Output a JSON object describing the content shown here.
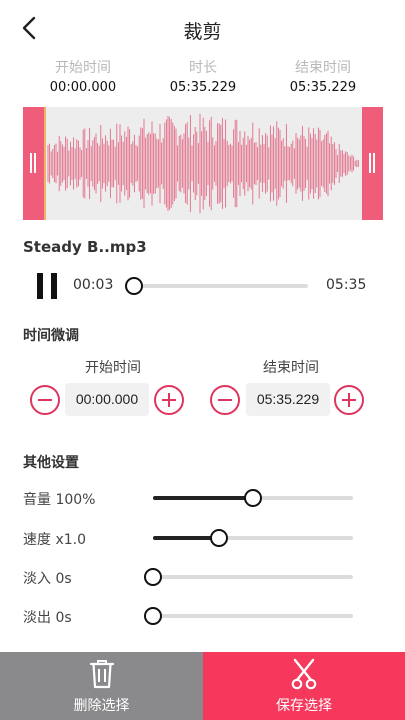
{
  "header": {
    "title": "裁剪",
    "back_icon": "back-arrow-icon"
  },
  "time_info": {
    "start_label": "开始时间",
    "start_value": "00:00.000",
    "duration_label": "时长",
    "duration_value": "05:35.229",
    "end_label": "结束时间",
    "end_value": "05:35.229"
  },
  "waveform": {
    "color": "#e16c86",
    "handle_color": "#ef5d7a"
  },
  "player": {
    "filename": "Steady B..mp3",
    "current": "00:03",
    "total": "05:35",
    "progress": 0.01,
    "state_icon": "pause-icon"
  },
  "fine_tune": {
    "section_label": "时间微调",
    "start_label": "开始时间",
    "start_value": "00:00.000",
    "end_label": "结束时间",
    "end_value": "05:35.229"
  },
  "other": {
    "section_label": "其他设置",
    "sliders": [
      {
        "label": "音量 100%",
        "value": 0.5
      },
      {
        "label": "速度 x1.0",
        "value": 0.33
      },
      {
        "label": "淡入 0s",
        "value": 0.0
      },
      {
        "label": "淡出 0s",
        "value": 0.0
      }
    ]
  },
  "bottom": {
    "delete_label": "删除选择",
    "save_label": "保存选择",
    "delete_icon": "trash-icon",
    "save_icon": "scissors-icon"
  },
  "colors": {
    "accent": "#f6385d",
    "delete_bg": "#8a8a8c",
    "stepper": "#e0345c"
  }
}
